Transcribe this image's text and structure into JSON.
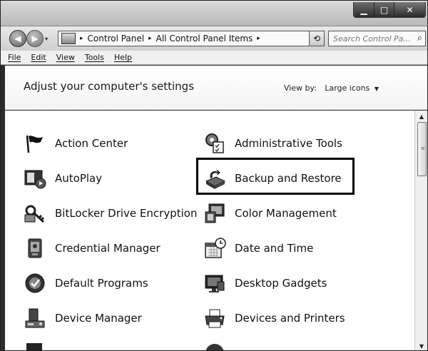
{
  "window": {
    "minimize_glyph": "▁",
    "maximize_glyph": "□",
    "close_glyph": "✕"
  },
  "address": {
    "back_glyph": "◀",
    "forward_glyph": "▶",
    "breadcrumb": [
      "Control Panel",
      "All Control Panel Items"
    ],
    "separator": "▸",
    "dropdown_glyph": "▾",
    "refresh_glyph": "⟲",
    "search_placeholder": "Search Control Pa...",
    "search_glyph": "⌕"
  },
  "menu": [
    "File",
    "Edit",
    "View",
    "Tools",
    "Help"
  ],
  "header": {
    "title": "Adjust your computer's settings",
    "view_by_label": "View by:",
    "view_by_value": "Large icons",
    "view_by_arrow": "▼"
  },
  "items": [
    {
      "label": "Action Center",
      "icon": "flag-icon"
    },
    {
      "label": "Administrative Tools",
      "icon": "admin-tools-icon"
    },
    {
      "label": "AutoPlay",
      "icon": "autoplay-icon"
    },
    {
      "label": "Backup and Restore",
      "icon": "backup-icon",
      "selected": true
    },
    {
      "label": "BitLocker Drive Encryption",
      "icon": "bitlocker-key-icon"
    },
    {
      "label": "Color Management",
      "icon": "color-management-icon"
    },
    {
      "label": "Credential Manager",
      "icon": "credential-icon"
    },
    {
      "label": "Date and Time",
      "icon": "calendar-clock-icon"
    },
    {
      "label": "Default Programs",
      "icon": "default-programs-icon"
    },
    {
      "label": "Desktop Gadgets",
      "icon": "gadgets-icon"
    },
    {
      "label": "Device Manager",
      "icon": "device-manager-icon"
    },
    {
      "label": "Devices and Printers",
      "icon": "printer-icon"
    }
  ],
  "scrollbar": {
    "up_glyph": "▲",
    "down_glyph": "▼",
    "grip_glyph": "≡"
  }
}
